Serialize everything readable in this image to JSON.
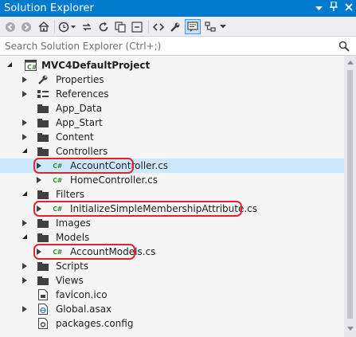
{
  "window": {
    "title": "Solution Explorer",
    "title_buttons": [
      "dropdown-icon",
      "pin-icon",
      "close-icon"
    ]
  },
  "toolbar": {
    "buttons": [
      "back-icon",
      "forward-icon",
      "home-icon",
      "history-icon",
      "sync-icon",
      "refresh-icon",
      "collapse-all-icon",
      "code-icon",
      "properties-icon",
      "preview-icon",
      "settings-icon",
      "dropdown-icon"
    ]
  },
  "search": {
    "placeholder": "Search Solution Explorer (Ctrl+;)"
  },
  "tree": {
    "items": [
      {
        "label": "MVC4DefaultProject",
        "icon": "project-icon",
        "expander": "expanded",
        "bold": true
      },
      {
        "label": "Properties",
        "icon": "wrench-icon",
        "expander": "collapsed"
      },
      {
        "label": "References",
        "icon": "references-icon",
        "expander": "collapsed"
      },
      {
        "label": "App_Data",
        "icon": "folder-icon",
        "expander": "none"
      },
      {
        "label": "App_Start",
        "icon": "folder-icon",
        "expander": "collapsed"
      },
      {
        "label": "Content",
        "icon": "folder-icon",
        "expander": "collapsed"
      },
      {
        "label": "Controllers",
        "icon": "folder-icon",
        "expander": "expanded"
      },
      {
        "label": "AccountController.cs",
        "icon": "csharp-file-icon",
        "expander": "collapsed",
        "selected": true,
        "highlighted": true
      },
      {
        "label": "HomeController.cs",
        "icon": "csharp-file-icon",
        "expander": "collapsed"
      },
      {
        "label": "Filters",
        "icon": "folder-icon",
        "expander": "expanded"
      },
      {
        "label": "InitializeSimpleMembershipAttribute.cs",
        "icon": "csharp-file-icon",
        "expander": "collapsed",
        "highlighted": true
      },
      {
        "label": "Images",
        "icon": "folder-icon",
        "expander": "collapsed"
      },
      {
        "label": "Models",
        "icon": "folder-icon",
        "expander": "expanded"
      },
      {
        "label": "AccountModels.cs",
        "icon": "csharp-file-icon",
        "expander": "collapsed",
        "highlighted": true
      },
      {
        "label": "Scripts",
        "icon": "folder-icon",
        "expander": "collapsed"
      },
      {
        "label": "Views",
        "icon": "folder-icon",
        "expander": "collapsed"
      },
      {
        "label": "favicon.ico",
        "icon": "image-file-icon",
        "expander": "none"
      },
      {
        "label": "Global.asax",
        "icon": "asax-file-icon",
        "expander": "collapsed"
      },
      {
        "label": "packages.config",
        "icon": "config-file-icon",
        "expander": "none"
      }
    ]
  },
  "colors": {
    "title_bar": "#007acc",
    "selection": "#cce8ff",
    "highlight_ring": "#e0242b",
    "csharp_badge": "#388a34"
  }
}
